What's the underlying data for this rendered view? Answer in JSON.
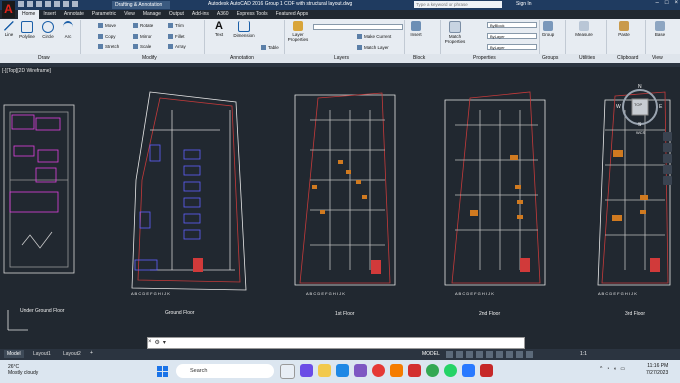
{
  "title_bar": {
    "workspace": "Drafting & Annotation",
    "app_title": "Autodesk AutoCAD 2016   Group 1 COF with structural layout.dwg",
    "search_placeholder": "Type a keyword or phrase",
    "sign_in": "Sign In"
  },
  "ribbon_tabs": [
    "Home",
    "Insert",
    "Annotate",
    "Parametric",
    "View",
    "Manage",
    "Output",
    "Add-ins",
    "A360",
    "Express Tools",
    "Featured Apps"
  ],
  "ribbon": {
    "draw": {
      "line": "Line",
      "polyline": "Polyline",
      "circle": "Circle",
      "arc": "Arc"
    },
    "modify": {
      "move": "Move",
      "rotate": "Rotate",
      "trim": "Trim",
      "copy": "Copy",
      "mirror": "Mirror",
      "fillet": "Fillet",
      "stretch": "Stretch",
      "scale": "Scale",
      "array": "Array"
    },
    "annotation": {
      "text": "Text",
      "dimension": "Dimension",
      "table": "Table"
    },
    "layers": {
      "layer_properties": "Layer Properties",
      "make_current": "Make Current",
      "match_layer": "Match Layer"
    },
    "block": {
      "insert": "Insert"
    },
    "properties": {
      "match_properties": "Match Properties",
      "byblock": "ByBlock",
      "bylayer1": "ByLayer",
      "bylayer2": "ByLayer"
    },
    "groups": {
      "group": "Group"
    },
    "utilities": {
      "measure": "Measure"
    },
    "clipboard": {
      "paste": "Paste"
    },
    "view": {
      "base": "Base"
    }
  },
  "panel_labels": [
    "Draw",
    "Modify",
    "Annotation",
    "Layers",
    "Block",
    "Properties",
    "Groups",
    "Utilities",
    "Clipboard",
    "View"
  ],
  "viewport_label": "[-][Top][2D Wireframe]",
  "viewcube": {
    "top": "TOP",
    "n": "N",
    "w": "W",
    "e": "E",
    "s": "S",
    "wcs": "WCS"
  },
  "drawings": [
    {
      "label": "Under Ground Floor"
    },
    {
      "label": "Ground  Floor"
    },
    {
      "label": "1st Floor"
    },
    {
      "label": "2nd Floor"
    },
    {
      "label": "3rd Floor"
    }
  ],
  "grid_letters": "A B C D E F G  H  I  J  K",
  "command_line": {
    "prompt": ""
  },
  "layout_tabs": [
    "Model",
    "Layout1",
    "Layout2"
  ],
  "status": {
    "model": "MODEL",
    "scale": "1:1"
  },
  "taskbar": {
    "temperature": "26°C",
    "weather": "Mostly cloudy",
    "search": "Search",
    "time": "11:16 PM",
    "date": "7/27/2023"
  },
  "colors": {
    "accent_red": "#e2231a",
    "canvas_bg": "#212830",
    "magenta": "#e040e0"
  }
}
